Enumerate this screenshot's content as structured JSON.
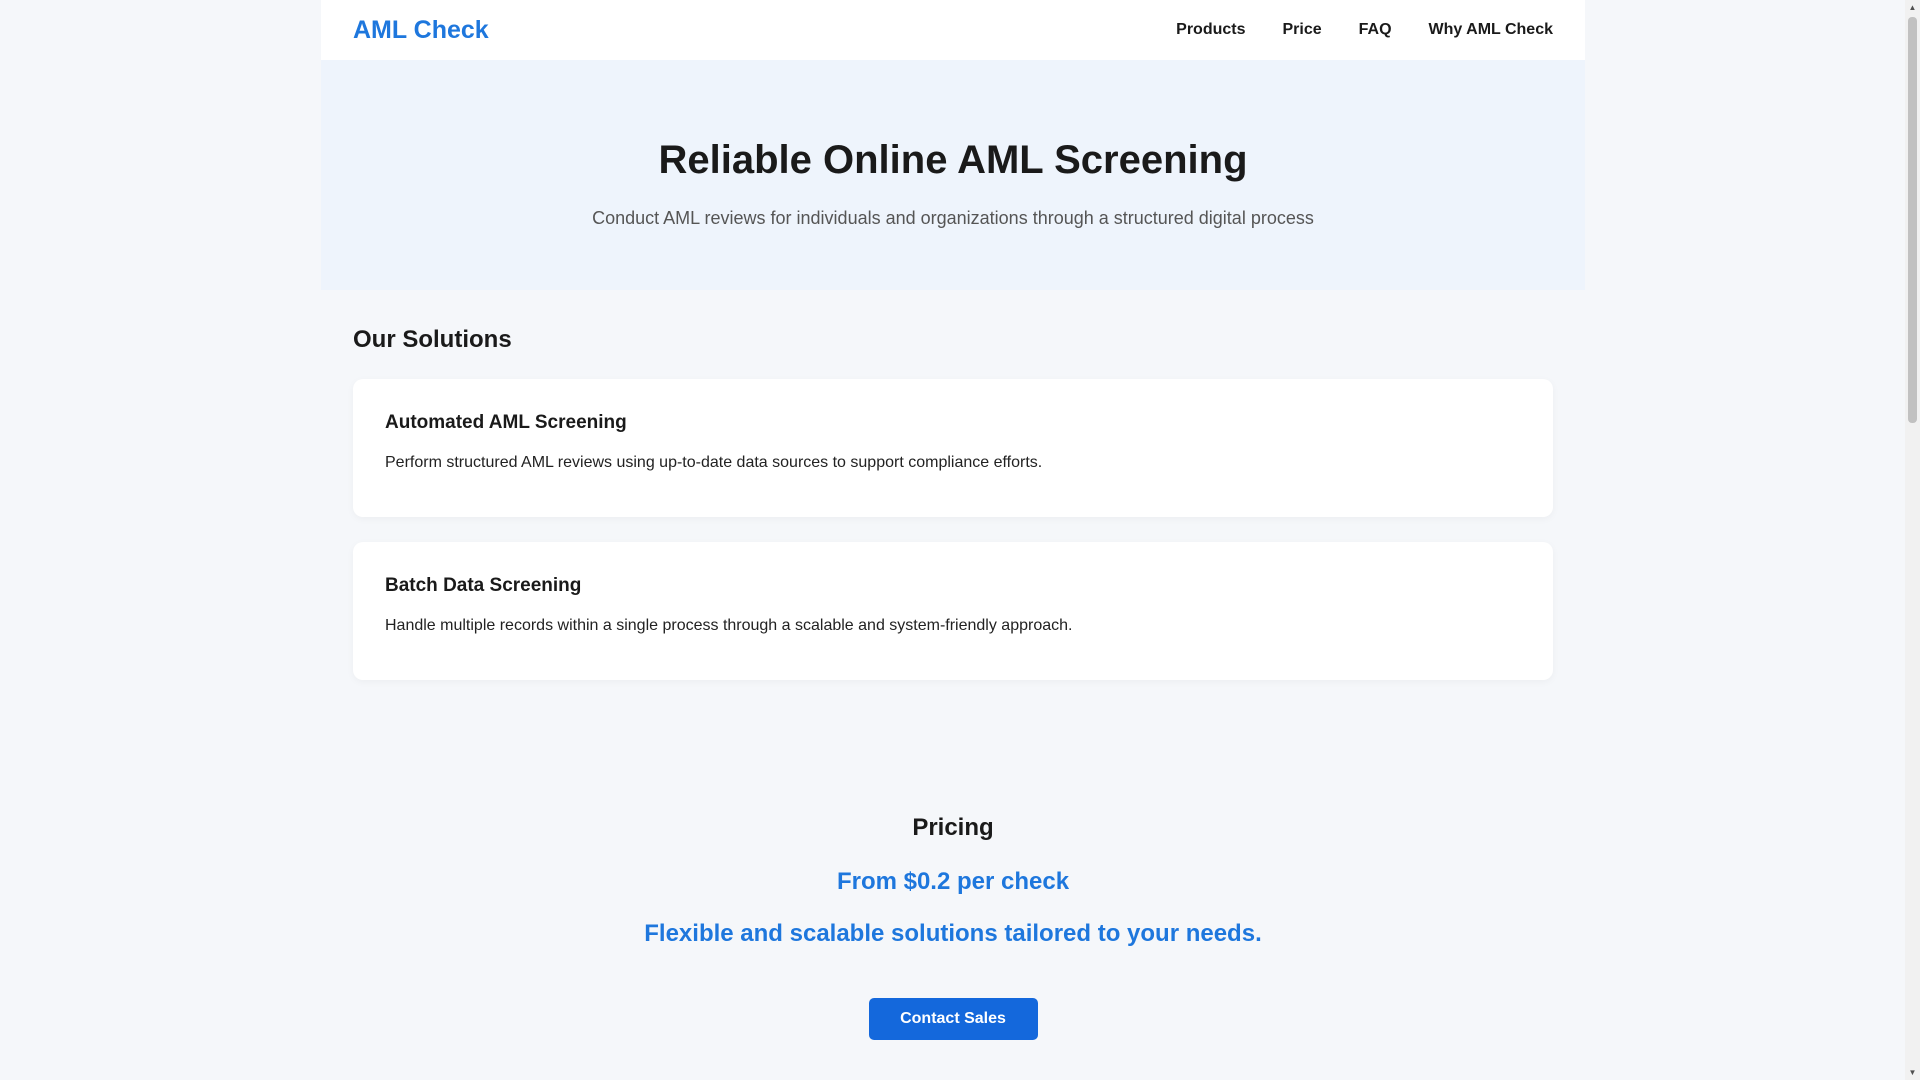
{
  "header": {
    "logo": "AML Check",
    "nav": [
      "Products",
      "Price",
      "FAQ",
      "Why AML Check"
    ]
  },
  "hero": {
    "title": "Reliable Online AML Screening",
    "subtitle": "Conduct AML reviews for individuals and organizations through a structured digital process"
  },
  "solutions": {
    "heading": "Our Solutions",
    "cards": [
      {
        "title": "Automated AML Screening",
        "description": "Perform structured AML reviews using up-to-date data sources to support compliance efforts."
      },
      {
        "title": "Batch Data Screening",
        "description": "Handle multiple records within a single process through a scalable and system-friendly approach."
      }
    ]
  },
  "pricing": {
    "heading": "Pricing",
    "price": "From $0.2 per check",
    "tagline": "Flexible and scalable solutions tailored to your needs.",
    "cta": "Contact Sales"
  },
  "colors": {
    "accent": "#1e77dd",
    "button": "#1468dc",
    "hero_bg": "#eef4fc",
    "page_bg": "#f5f7fa"
  },
  "icons": {
    "scroll_up": "▲",
    "scroll_down": "▼"
  }
}
